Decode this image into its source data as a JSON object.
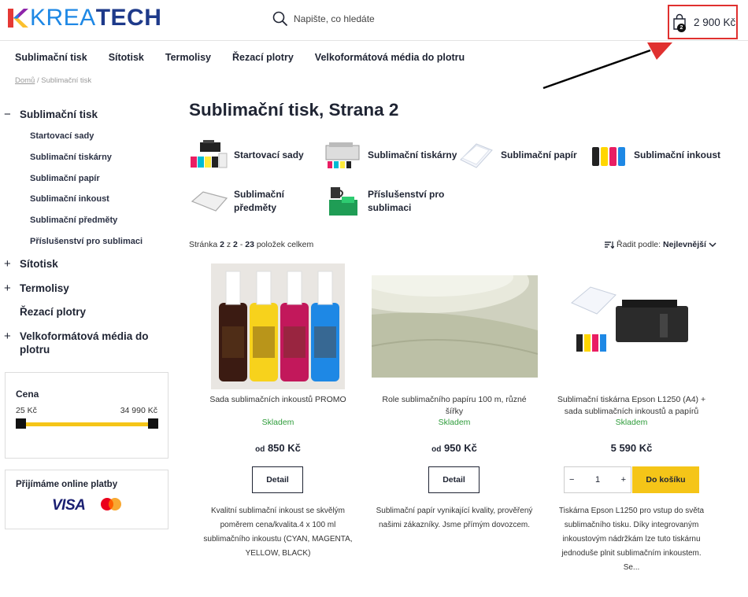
{
  "colors": {
    "accent": "#f5c518",
    "brand_blue": "#1e3a8a",
    "stock_green": "#2e9c3a",
    "highlight_red": "#e0302f"
  },
  "header": {
    "logo_part1": "KREA",
    "logo_part2": "TECH",
    "search_placeholder": "Napište, co hledáte",
    "cart_count": "2",
    "cart_total": "2 900 Kč"
  },
  "nav": [
    "Sublimační tisk",
    "Sítotisk",
    "Termolisy",
    "Řezací plotry",
    "Velkoformátová média do plotru"
  ],
  "breadcrumb": {
    "home": "Domů",
    "separator": " / ",
    "current": "Sublimační tisk"
  },
  "sidebar": {
    "active_category": "Sublimační tisk",
    "subcategories": [
      "Startovací sady",
      "Sublimační tiskárny",
      "Sublimační papír",
      "Sublimační inkoust",
      "Sublimační předměty",
      "Příslušenství pro sublimaci"
    ],
    "categories": [
      "Sítotisk",
      "Termolisy",
      "Řezací plotry",
      "Velkoformátová média do plotru"
    ]
  },
  "price_filter": {
    "title": "Cena",
    "min": "25 Kč",
    "max": "34 990 Kč",
    "range_from": 0,
    "range_to": 1
  },
  "payments": {
    "title": "Přijímáme online platby",
    "visa": "VISA"
  },
  "main": {
    "title": "Sublimační tisk, Strana 2",
    "categories": [
      "Startovací sady",
      "Sublimační tiskárny",
      "Sublimační papír",
      "Sublimační inkoust",
      "Sublimační předměty",
      "Příslušenství pro sublimaci"
    ],
    "paging": {
      "label": "Stránka",
      "page": "2",
      "of": "z",
      "total_pages": "2",
      "dash": "-",
      "items": "23",
      "items_label": "položek celkem"
    },
    "sort": {
      "label": "Řadit podle:",
      "value": "Nejlevnější"
    }
  },
  "products": [
    {
      "name": "Sada sublimačních inkoustů PROMO",
      "stock": "Skladem",
      "price_prefix": "od",
      "price": "850 Kč",
      "button": "Detail",
      "desc": "Kvalitní sublimační inkoust se skvělým poměrem cena/kvalita.4 x 100 ml sublimačního inkoustu (CYAN, MAGENTA, YELLOW, BLACK)"
    },
    {
      "name": "Role sublimačního papíru 100 m, různé šířky",
      "stock": "Skladem",
      "price_prefix": "od",
      "price": "950 Kč",
      "button": "Detail",
      "desc": "Sublimační papír vynikající kvality, prověřený našimi zákazníky. Jsme přímým dovozcem."
    },
    {
      "name": "Sublimační tiskárna Epson L1250 (A4) + sada sublimačních inkoustů a papírů",
      "stock": "Skladem",
      "price": "5 590 Kč",
      "qty": "1",
      "qty_minus": "−",
      "qty_plus": "+",
      "button": "Do košíku",
      "desc": "Tiskárna Epson L1250 pro vstup do světa sublimačního tisku. Díky integrovaným inkoustovým nádržkám lze tuto tiskárnu jednoduše plnit sublimačním inkoustem. Se..."
    }
  ]
}
